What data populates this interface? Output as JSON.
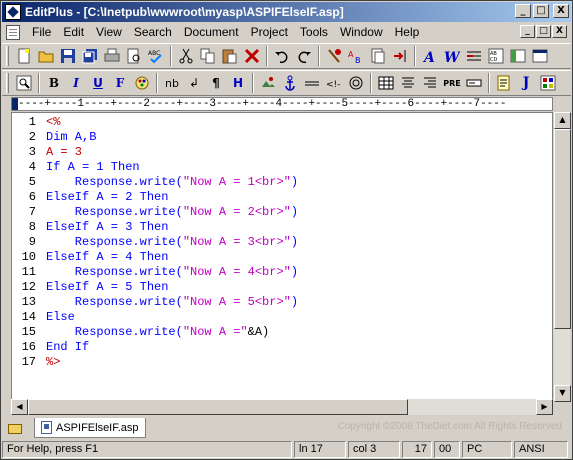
{
  "titlebar": {
    "title": "EditPlus - [C:\\Inetpub\\wwwroot\\myasp\\ASPIFElseIF.asp]",
    "minimize": "_",
    "maximize": "□",
    "close": "X"
  },
  "menu": {
    "items": [
      "File",
      "Edit",
      "View",
      "Search",
      "Document",
      "Project",
      "Tools",
      "Window",
      "Help"
    ]
  },
  "toolbar2": {
    "bold": "B",
    "italic": "I",
    "underline": "U",
    "font": "F",
    "nbsp": "nb",
    "break": "↲",
    "para": "¶",
    "heading": "H",
    "pre": "PRE",
    "javascript": "J"
  },
  "ruler": {
    "text": "----+----1----+----2----+----3----+----4----+----5----+----6----+----7----"
  },
  "editor": {
    "lines": [
      {
        "n": "1",
        "parts": [
          {
            "t": "<%",
            "c": "red"
          }
        ]
      },
      {
        "n": "2",
        "parts": [
          {
            "t": "Dim A,B",
            "c": "kw"
          }
        ]
      },
      {
        "n": "3",
        "parts": [
          {
            "t": "A = 3",
            "c": "red"
          }
        ]
      },
      {
        "n": "4",
        "parts": [
          {
            "t": "If A = 1 Then",
            "c": "kw"
          }
        ]
      },
      {
        "n": "5",
        "parts": [
          {
            "t": "    Response.write(",
            "c": "kw"
          },
          {
            "t": "\"Now A = 1<br>\"",
            "c": "str"
          },
          {
            "t": ")",
            "c": "kw"
          }
        ]
      },
      {
        "n": "6",
        "parts": [
          {
            "t": "ElseIf A = 2 Then",
            "c": "kw"
          }
        ]
      },
      {
        "n": "7",
        "parts": [
          {
            "t": "    Response.write(",
            "c": "kw"
          },
          {
            "t": "\"Now A = 2<br>\"",
            "c": "str"
          },
          {
            "t": ")",
            "c": "kw"
          }
        ]
      },
      {
        "n": "8",
        "parts": [
          {
            "t": "ElseIf A = 3 Then",
            "c": "kw"
          }
        ]
      },
      {
        "n": "9",
        "parts": [
          {
            "t": "    Response.write(",
            "c": "kw"
          },
          {
            "t": "\"Now A = 3<br>\"",
            "c": "str"
          },
          {
            "t": ")",
            "c": "kw"
          }
        ]
      },
      {
        "n": "10",
        "parts": [
          {
            "t": "ElseIf A = 4 Then",
            "c": "kw"
          }
        ]
      },
      {
        "n": "11",
        "parts": [
          {
            "t": "    Response.write(",
            "c": "kw"
          },
          {
            "t": "\"Now A = 4<br>\"",
            "c": "str"
          },
          {
            "t": ")",
            "c": "kw"
          }
        ]
      },
      {
        "n": "12",
        "parts": [
          {
            "t": "ElseIf A = 5 Then",
            "c": "kw"
          }
        ]
      },
      {
        "n": "13",
        "parts": [
          {
            "t": "    Response.write(",
            "c": "kw"
          },
          {
            "t": "\"Now A = 5<br>\"",
            "c": "str"
          },
          {
            "t": ")",
            "c": "kw"
          }
        ]
      },
      {
        "n": "14",
        "parts": [
          {
            "t": "Else",
            "c": "kw"
          }
        ]
      },
      {
        "n": "15",
        "parts": [
          {
            "t": "    Response.write(",
            "c": "kw"
          },
          {
            "t": "\"Now A =\"",
            "c": "str"
          },
          {
            "t": "&A)",
            "c": "txt"
          }
        ]
      },
      {
        "n": "16",
        "parts": [
          {
            "t": "End If",
            "c": "kw"
          }
        ]
      },
      {
        "n": "17",
        "parts": [
          {
            "t": "%>",
            "c": "red"
          }
        ]
      }
    ]
  },
  "tabs": {
    "active": "ASPIFElseIF.asp"
  },
  "watermark": "Copyright ©2008 TheDiet.com All Rights Reserved",
  "statusbar": {
    "help": "For Help, press F1",
    "line": "ln 17",
    "col": "col 3",
    "num": "17",
    "code": "00",
    "mode": "PC",
    "encoding": "ANSI"
  },
  "colors": {
    "keyword": "#0000ff",
    "string": "#c000c0",
    "delimiter": "#c00000",
    "titlebar_start": "#0a246a",
    "titlebar_end": "#a6caf0"
  }
}
